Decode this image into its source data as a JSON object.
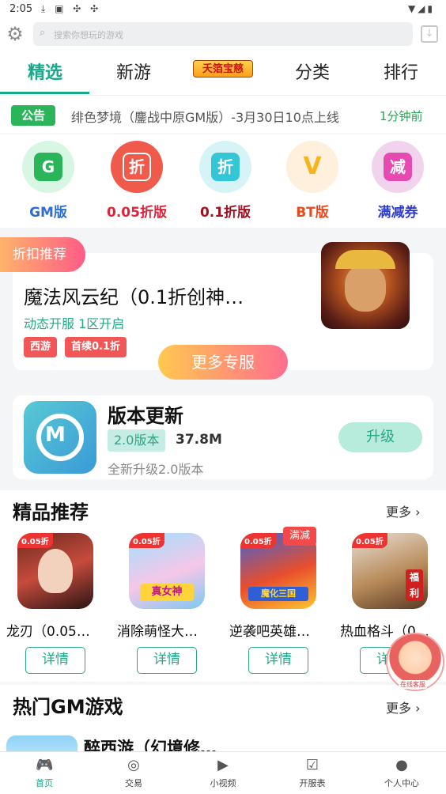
{
  "status_bar": {
    "time": "2:05"
  },
  "search": {
    "placeholder": "搜索你想玩的游戏"
  },
  "tabs": [
    {
      "label": "精选",
      "active": true
    },
    {
      "label": "新游"
    },
    {
      "label": "夭箔宝慈"
    },
    {
      "label": "分类"
    },
    {
      "label": "排行"
    }
  ],
  "notice": {
    "badge": "公告",
    "text": "绯色梦境（鏖战中原GM版）-3月30日10点上线",
    "time_ago": "1分钟前"
  },
  "categories": [
    {
      "label": "GM版",
      "glyph": "G",
      "color": "#2d6ed6",
      "icon_bg": "#d8f6e4",
      "inner": "#2bb55a"
    },
    {
      "label": "0.05折版",
      "glyph": "折",
      "color": "#e0223b",
      "icon_bg": "#ef5a4b",
      "inner": "#ef5a4b"
    },
    {
      "label": "0.1折版",
      "glyph": "折",
      "color": "#a2101f",
      "icon_bg": "#d6f4f6",
      "inner": "#35c6d6"
    },
    {
      "label": "BT版",
      "glyph": "V",
      "color": "#e74a1e",
      "icon_bg": "#fff0dd",
      "inner": "#f6b41d"
    },
    {
      "label": "满减券",
      "glyph": "减",
      "color": "#2d3bd0",
      "icon_bg": "#f2d3ee",
      "inner": "#e64ab0"
    }
  ],
  "discount": {
    "tag": "折扣推荐",
    "title": "魔法风云纪（0.1折创神…",
    "subtitle": "动态开服 1区开启",
    "pills": [
      "西游",
      "首续0.1折"
    ],
    "more_label": "更多专服"
  },
  "version": {
    "title": "版本更新",
    "badge": "2.0版本",
    "size": "37.8M",
    "desc": "全新升级2.0版本",
    "button": "升级"
  },
  "recommend": {
    "title": "精品推荐",
    "more": "更多",
    "detail_label": "详情",
    "badge": "满减",
    "games": [
      {
        "name": "龙刃（0.05…",
        "tag": "0.05折"
      },
      {
        "name": "消除萌怪大…",
        "tag": "0.05折"
      },
      {
        "name": "逆袭吧英雄…",
        "tag": "0.05折"
      },
      {
        "name": "热血格斗（0…",
        "tag": "0.05折"
      }
    ]
  },
  "hot_gm": {
    "title": "热门GM游戏",
    "more": "更多",
    "first_game": "醉西游（幻境修…"
  },
  "service": {
    "label": "在线客服"
  },
  "bottom_nav": [
    {
      "label": "首页",
      "icon": "gamepad-icon",
      "active": true
    },
    {
      "label": "交易",
      "icon": "trade-icon"
    },
    {
      "label": "小视频",
      "icon": "video-icon"
    },
    {
      "label": "开服表",
      "icon": "clipboard-icon"
    },
    {
      "label": "个人中心",
      "icon": "user-icon"
    }
  ]
}
